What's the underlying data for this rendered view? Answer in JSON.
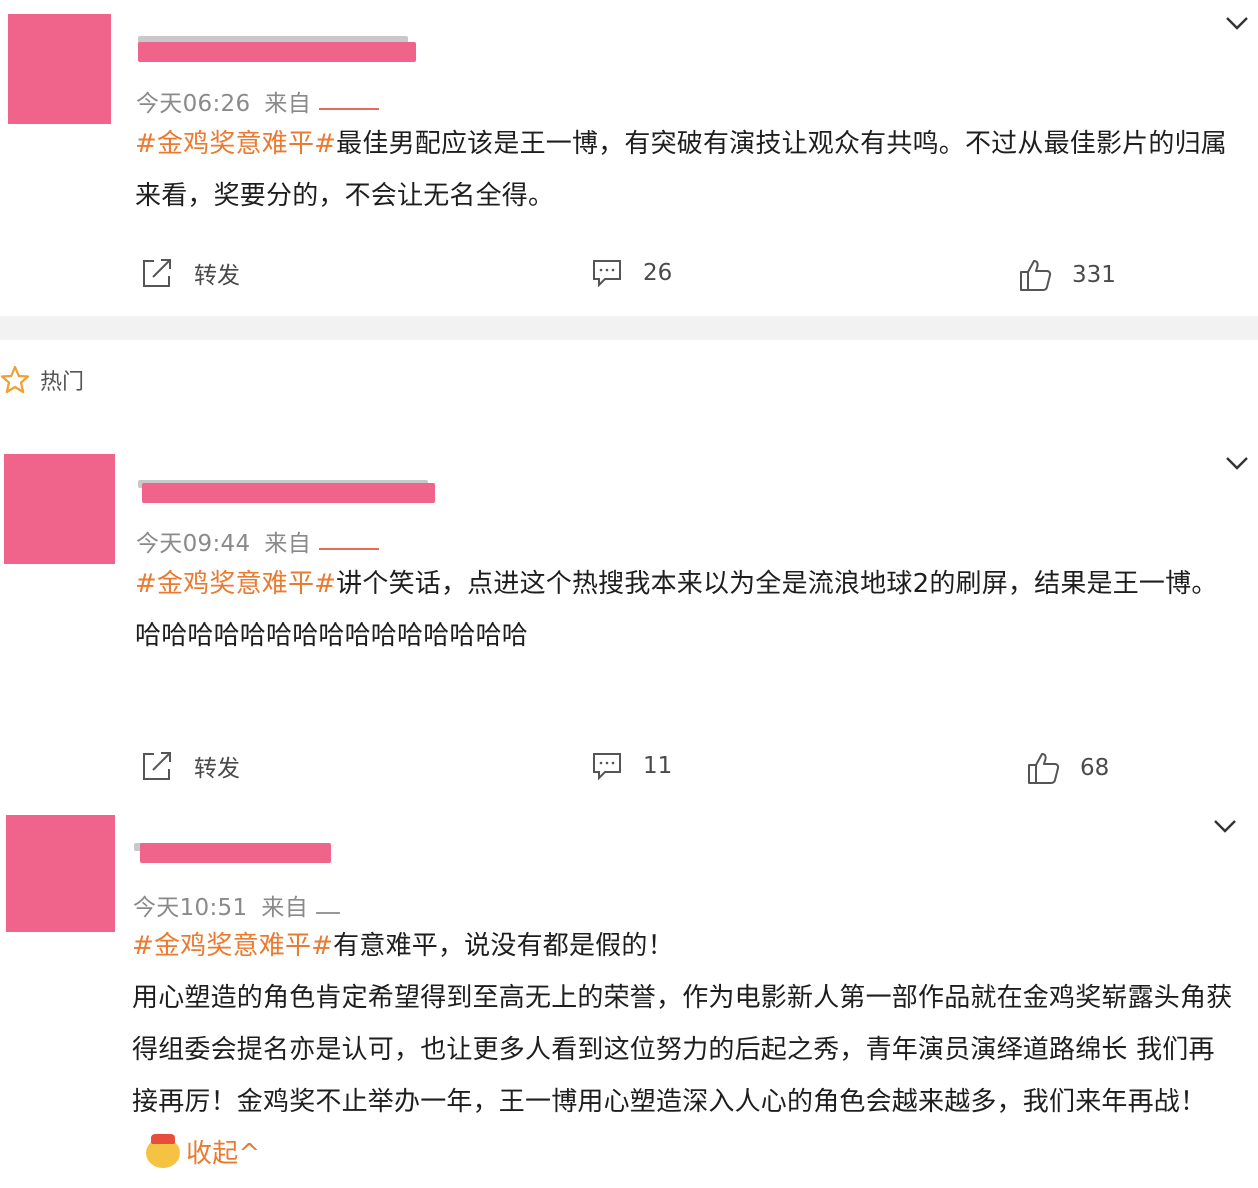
{
  "colors": {
    "accent": "#ea7a2f",
    "avatar_redact": "#f0648c",
    "meta_text": "#8a8a8a"
  },
  "posts": [
    {
      "meta": {
        "time": "今天06:26",
        "source_prefix": "来自"
      },
      "tag": "#金鸡奖意难平#",
      "paragraphs": [
        "最佳男配应该是王一博，有突破有演技让观众有共鸣。不过从最佳影片的归属来看，奖要分的，不会让无名全得。"
      ],
      "actions": {
        "repost_label": "转发",
        "comment_count": "26",
        "like_count": "331"
      },
      "icons": {
        "menu": "chevron-down-icon",
        "repost": "share-icon",
        "comment": "comment-icon",
        "like": "thumbs-up-icon"
      }
    },
    {
      "meta": {
        "time": "今天09:44",
        "source_prefix": "来自"
      },
      "tag": "#金鸡奖意难平#",
      "paragraphs": [
        "讲个笑话，点进这个热搜我本来以为全是流浪地球2的刷屏，结果是王一博。",
        "哈哈哈哈哈哈哈哈哈哈哈哈哈哈哈"
      ],
      "actions": {
        "repost_label": "转发",
        "comment_count": "11",
        "like_count": "68"
      }
    },
    {
      "meta": {
        "time": "今天10:51",
        "source_prefix": "来自"
      },
      "tag": "#金鸡奖意难平#",
      "paragraphs": [
        "有意难平，说没有都是假的！",
        "用心塑造的角色肯定希望得到至高无上的荣誉，作为电影新人第一部作品就在金鸡奖崭露头角获得组委会提名亦是认可，也让更多人看到这位努力的后起之秀，青年演员演绎道路绵长 我们再接再厉！金鸡奖不止举办一年，王一博用心塑造深入人心的角色会越来越多，我们来年再战！"
      ],
      "collapse_label": "收起^"
    }
  ],
  "hot_section": {
    "label": "热门",
    "icon": "star-icon"
  }
}
